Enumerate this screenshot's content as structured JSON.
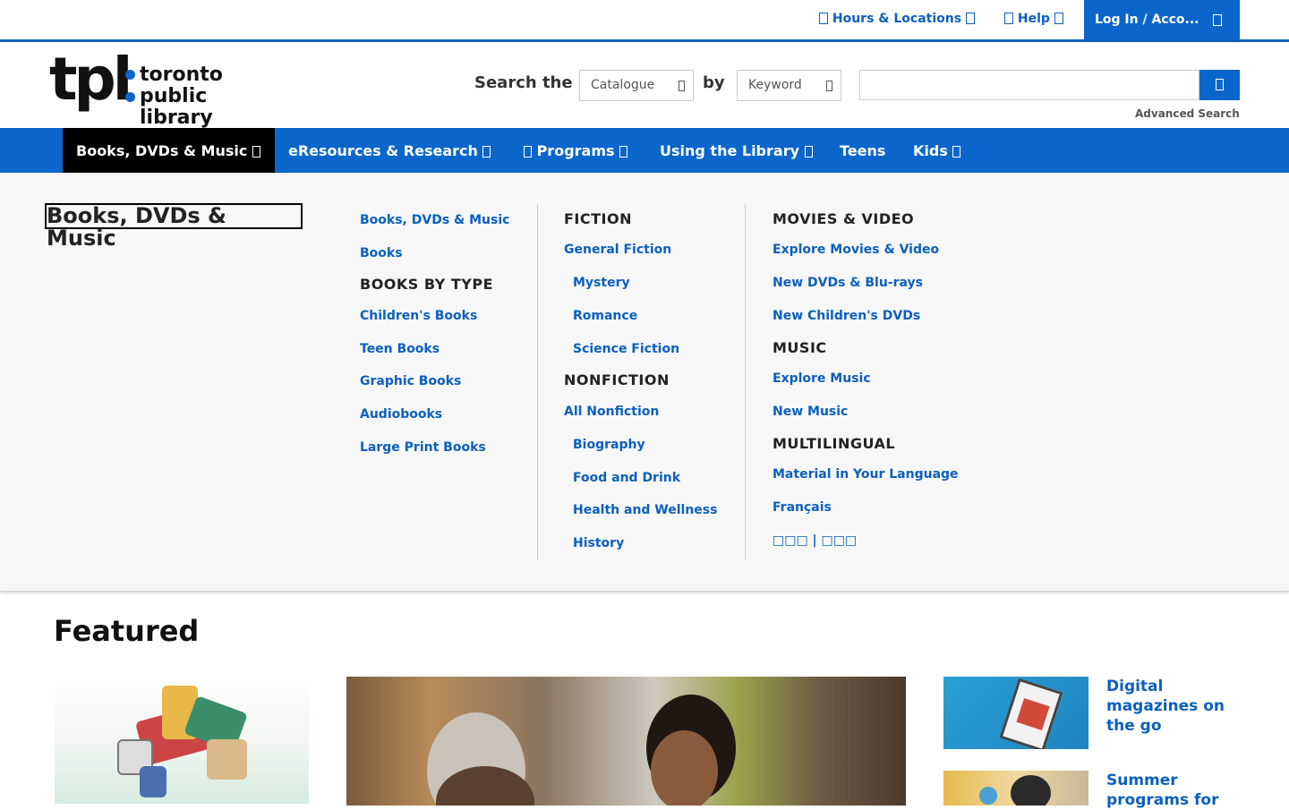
{
  "topbar": {
    "hours": "Hours & Locations",
    "help": "Help",
    "login": "Log In / Acco..."
  },
  "logo": {
    "mark": "tpl",
    "line1": "toronto",
    "line2": "public library"
  },
  "search": {
    "label_search": "Search the",
    "scope": "Catalogue",
    "label_by": "by",
    "by": "Keyword",
    "query": "",
    "advanced": "Advanced Search"
  },
  "nav": [
    {
      "label": "Books, DVDs & Music"
    },
    {
      "label": "eResources & Research"
    },
    {
      "label": "Programs"
    },
    {
      "label": "Using the Library"
    },
    {
      "label": "Teens"
    },
    {
      "label": "Kids"
    }
  ],
  "mega": {
    "title": "Books, DVDs & Music",
    "col1": {
      "link_all": "Books, DVDs & Music",
      "link_books": "Books",
      "heading": "BOOKS BY TYPE",
      "items": [
        "Children's Books",
        "Teen Books",
        "Graphic Books",
        "Audiobooks",
        "Large Print Books"
      ]
    },
    "col2": {
      "fiction_heading": "FICTION",
      "fiction_main": "General Fiction",
      "fiction_items": [
        "Mystery",
        "Romance",
        "Science Fiction"
      ],
      "nonfiction_heading": "NONFICTION",
      "nonfiction_main": "All Nonfiction",
      "nonfiction_items": [
        "Biography",
        "Food and Drink",
        "Health and Wellness",
        "History"
      ]
    },
    "col3": {
      "movies_heading": "MOVIES & VIDEO",
      "movies_items": [
        "Explore Movies & Video",
        "New DVDs & Blu-rays",
        "New Children's DVDs"
      ],
      "music_heading": "MUSIC",
      "music_items": [
        "Explore Music",
        "New Music"
      ],
      "multi_heading": "MULTILINGUAL",
      "multi_items": [
        "Material in Your Language",
        "Français",
        "□□□ | □□□"
      ]
    }
  },
  "featured": {
    "heading": "Featured",
    "side": [
      {
        "title": "Digital magazines on the go"
      },
      {
        "title": "Summer programs for"
      }
    ]
  },
  "colors": {
    "brand": "#0b66cc",
    "link": "#0b5fbf",
    "active_nav": "#000000"
  }
}
